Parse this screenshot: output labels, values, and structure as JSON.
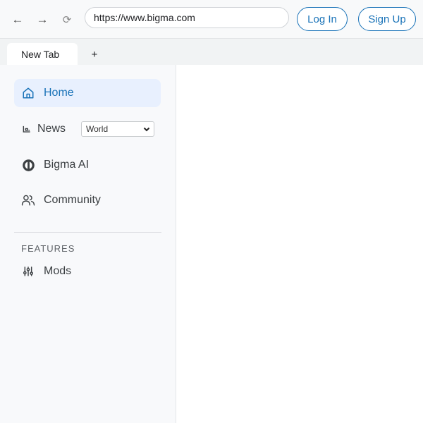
{
  "toolbar": {
    "back_glyph": "←",
    "forward_glyph": "→",
    "reload_glyph": "⟳",
    "url": "https://www.bigma.com",
    "login_label": "Log In",
    "signup_label": "Sign Up"
  },
  "tabs": [
    {
      "label": "New Tab",
      "active": true
    }
  ],
  "new_tab_glyph": "+",
  "sidebar": {
    "items": [
      {
        "label": "Home",
        "icon": "home-icon",
        "active": true
      },
      {
        "label": "News",
        "icon": "news-icon",
        "active": false,
        "select_value": "World"
      },
      {
        "label": "Bigma AI",
        "icon": "bigma-ai-icon",
        "active": false
      },
      {
        "label": "Community",
        "icon": "people-icon",
        "active": false
      }
    ],
    "section_heading": "FEATURES",
    "features": [
      {
        "label": "Mods",
        "icon": "sliders-icon"
      }
    ]
  },
  "colors": {
    "accent": "#1a73b8",
    "active_bg": "#e8f0fe",
    "sidebar_bg": "#f8f9fb"
  }
}
